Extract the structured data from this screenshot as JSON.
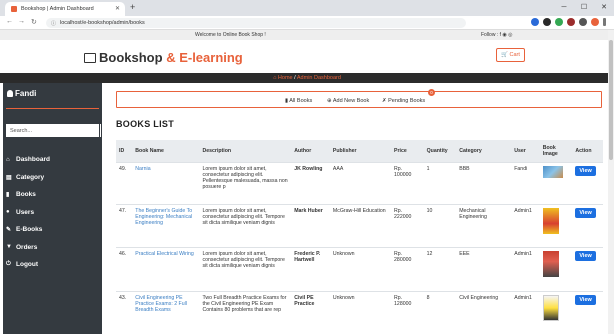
{
  "browser": {
    "tab_title": "Bookshop | Admin Dashboard",
    "url": "localhost/e-bookshop/admin/books"
  },
  "site": {
    "welcome": "Welcome to Online Book Shop !",
    "follow": "Follow : f",
    "brand_main": "Bookshop",
    "brand_accent": "& E-learning",
    "cart": "Cart"
  },
  "breadcrumb": {
    "home": "Home",
    "sep": "/",
    "current": "Admin Dashboard"
  },
  "sidebar": {
    "user": "Fandi",
    "search_placeholder": "Search...",
    "items": [
      {
        "label": "Dashboard",
        "icon": "home-icon"
      },
      {
        "label": "Category",
        "icon": "folder-icon"
      },
      {
        "label": "Books",
        "icon": "book-icon"
      },
      {
        "label": "Users",
        "icon": "users-icon"
      },
      {
        "label": "E-Books",
        "icon": "ebook-icon"
      },
      {
        "label": "Orders",
        "icon": "cart-icon"
      },
      {
        "label": "Logout",
        "icon": "power-icon"
      }
    ]
  },
  "actions": {
    "all": "All Books",
    "add": "Add New Book",
    "pending": "Pending Books",
    "pending_count": "0"
  },
  "page_title": "BOOKS LIST",
  "table": {
    "headers": [
      "ID",
      "Book Name",
      "Description",
      "Author",
      "Publisher",
      "Price",
      "Quantity",
      "Category",
      "User",
      "Book Image",
      "Action"
    ],
    "rows": [
      {
        "id": "49.",
        "name": "Narnia",
        "desc": "Lorem ipsum dolor sit amet, consectetur adipiscing elit. Pellentesque malesuada, massa non posuere p",
        "author": "JK Rowling",
        "publisher": "AAA",
        "price": "Rp. 100000",
        "qty": "1",
        "category": "BBB",
        "user": "Fandi",
        "action": "View"
      },
      {
        "id": "47.",
        "name": "The Beginner's Guide To Engineering: Mechanical Engineering",
        "desc": "Lorem ipsum dolor sit amet, consectetur adipiscing elit. Tempore sit dicta similique veniam dignis",
        "author": "Mark Huber",
        "publisher": "McGraw-Hill Education",
        "price": "Rp. 222000",
        "qty": "10",
        "category": "Mechanical Engineering",
        "user": "Admin1",
        "action": "View"
      },
      {
        "id": "46.",
        "name": "Practical Electrical Wiring",
        "desc": "Lorem ipsum dolor sit amet, consectetur adipiscing elit. Tempore sit dicta similique veniam dignis",
        "author": "Frederic P. Hartwell",
        "publisher": "Unknown",
        "price": "Rp. 280000",
        "qty": "12",
        "category": "EEE",
        "user": "Admin1",
        "action": "View"
      },
      {
        "id": "43.",
        "name": "Civil Engineering PE Practice Exams: 2 Full Breadth Exams",
        "desc": "Two Full Breadth Practice Exams for the Civil Engineering PE Exam Contains 80 problems that are rep",
        "author": "Civil PE Practice",
        "publisher": "Unknown",
        "price": "Rp. 128000",
        "qty": "8",
        "category": "Civil Engineering",
        "user": "Admin1",
        "action": "View"
      }
    ]
  },
  "colors": {
    "accent": "#e8623b",
    "sidebar": "#343a40",
    "view_button": "#1c6fe0"
  }
}
